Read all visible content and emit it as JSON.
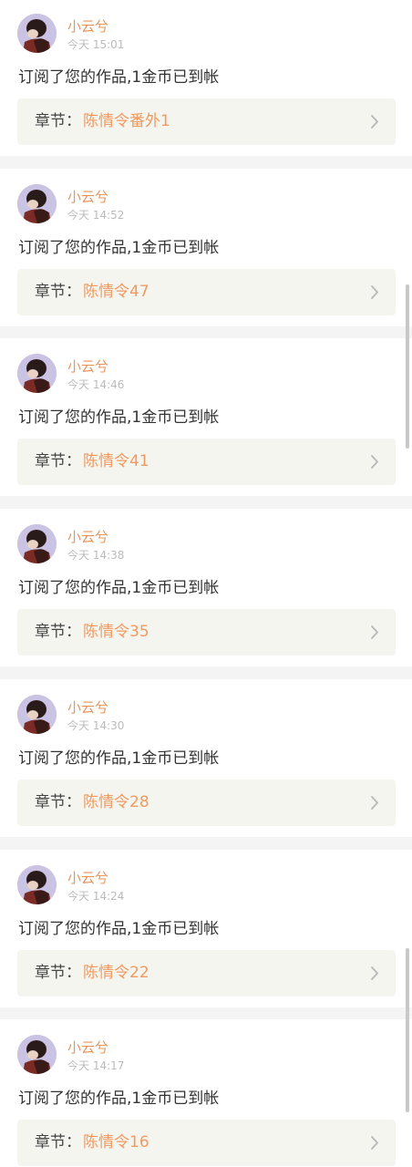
{
  "items": [
    {
      "user": "小云兮",
      "time": "今天 15:01",
      "message": "订阅了您的作品,1金币已到帐",
      "chapter_prefix": "章节：",
      "chapter": "陈情令番外1"
    },
    {
      "user": "小云兮",
      "time": "今天 14:52",
      "message": "订阅了您的作品,1金币已到帐",
      "chapter_prefix": "章节：",
      "chapter": "陈情令47"
    },
    {
      "user": "小云兮",
      "time": "今天 14:46",
      "message": "订阅了您的作品,1金币已到帐",
      "chapter_prefix": "章节：",
      "chapter": "陈情令41"
    },
    {
      "user": "小云兮",
      "time": "今天 14:38",
      "message": "订阅了您的作品,1金币已到帐",
      "chapter_prefix": "章节：",
      "chapter": "陈情令35"
    },
    {
      "user": "小云兮",
      "time": "今天 14:30",
      "message": "订阅了您的作品,1金币已到帐",
      "chapter_prefix": "章节：",
      "chapter": "陈情令28"
    },
    {
      "user": "小云兮",
      "time": "今天 14:24",
      "message": "订阅了您的作品,1金币已到帐",
      "chapter_prefix": "章节：",
      "chapter": "陈情令22"
    },
    {
      "user": "小云兮",
      "time": "今天 14:17",
      "message": "订阅了您的作品,1金币已到帐",
      "chapter_prefix": "章节：",
      "chapter": "陈情令16"
    }
  ],
  "icons": {
    "avatar": "user-avatar-image",
    "chevron": "chevron-right-icon"
  },
  "colors": {
    "username": "#e8955c",
    "chapter_title": "#ee9a62",
    "time": "#bbbbbb",
    "message": "#333333",
    "chapter_box": "#f5f5ef",
    "separator": "#f4f4f4"
  }
}
